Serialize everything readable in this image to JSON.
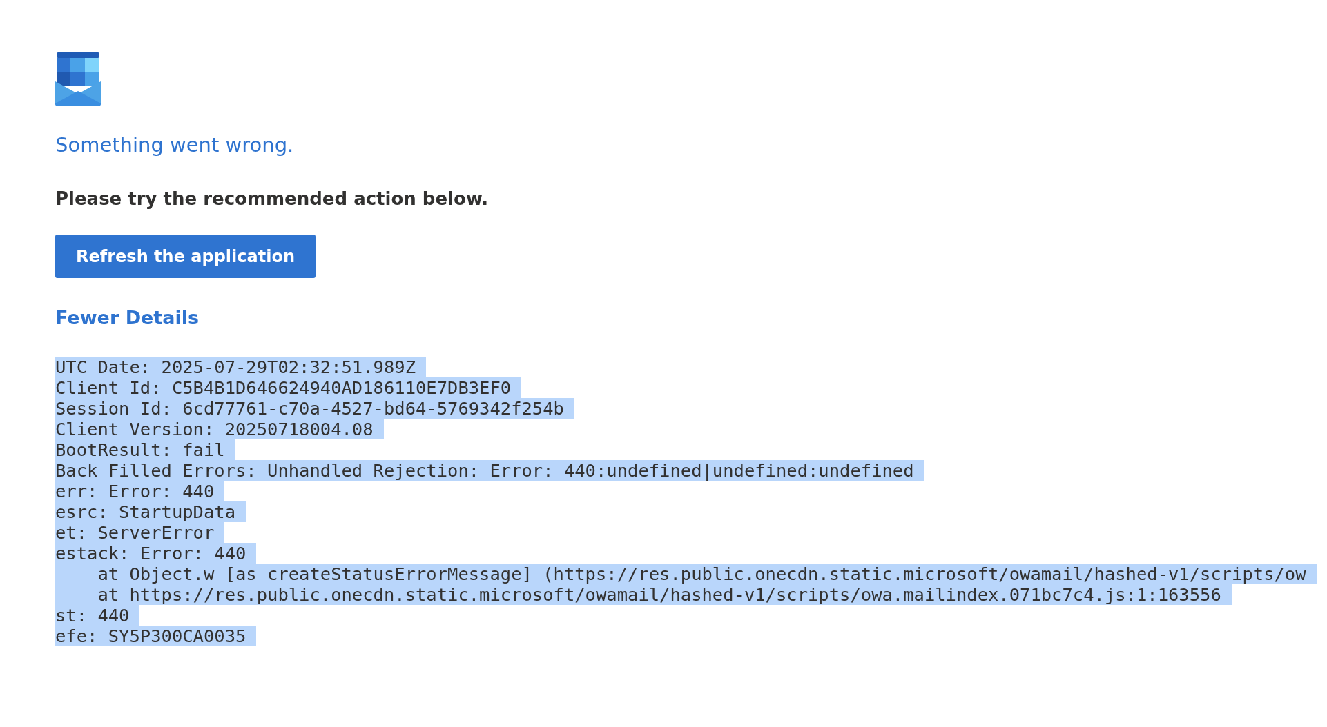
{
  "title": "Something went wrong.",
  "message": "Please try the recommended action below.",
  "action_button": "Refresh the application",
  "details_toggle": "Fewer Details",
  "details": {
    "selected": true,
    "lines": [
      "UTC Date: 2025-07-29T02:32:51.989Z",
      "Client Id: C5B4B1D646624940AD186110E7DB3EF0",
      "Session Id: 6cd77761-c70a-4527-bd64-5769342f254b",
      "Client Version: 20250718004.08",
      "BootResult: fail",
      "Back Filled Errors: Unhandled Rejection: Error: 440:undefined|undefined:undefined",
      "err: Error: 440",
      "esrc: StartupData",
      "et: ServerError",
      "estack: Error: 440",
      "    at Object.w [as createStatusErrorMessage] (https://res.public.onecdn.static.microsoft/owamail/hashed-v1/scripts/ow",
      "    at https://res.public.onecdn.static.microsoft/owamail/hashed-v1/scripts/owa.mailindex.071bc7c4.js:1:163556",
      "st: 440",
      "efe: SY5P300CA0035"
    ]
  }
}
